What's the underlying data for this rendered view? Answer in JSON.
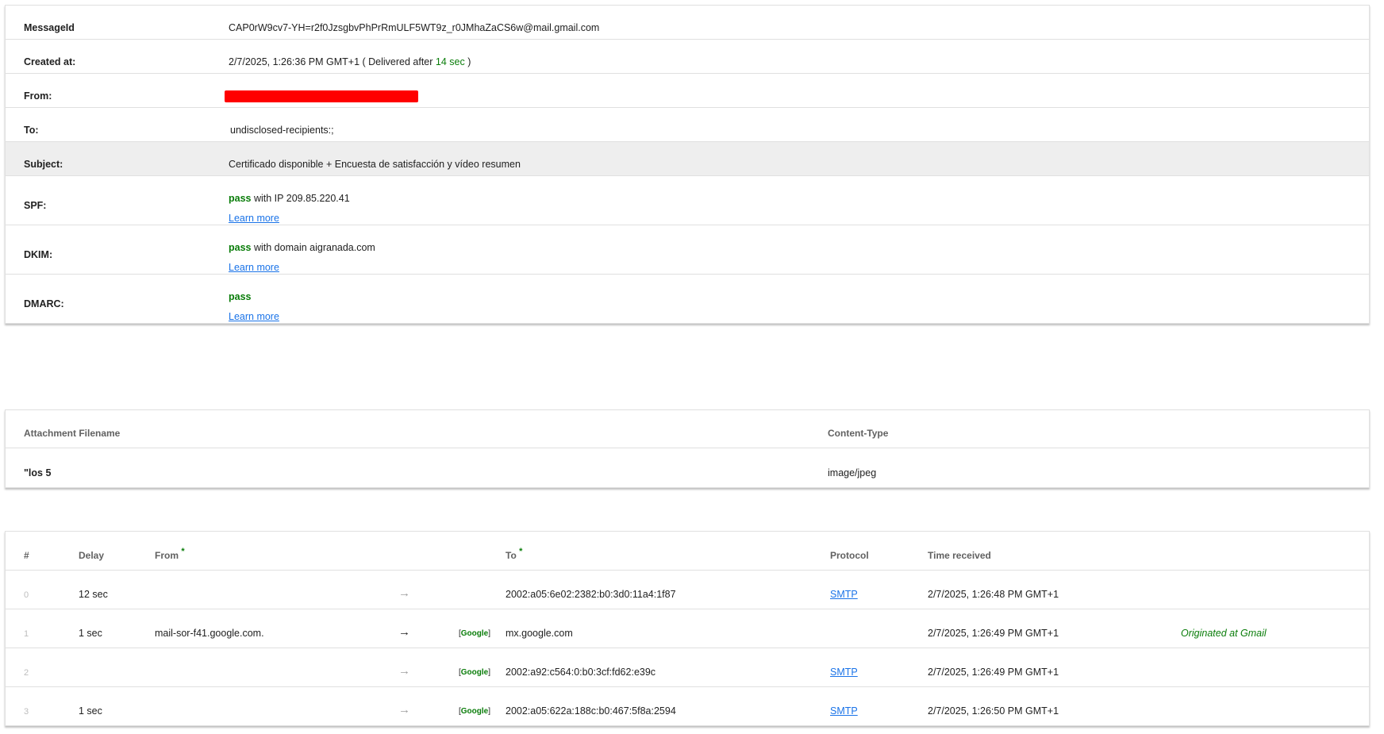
{
  "summary": {
    "rows": [
      {
        "label": "MessageId",
        "value": "CAP0rW9cv7-YH=r2f0JzsgbvPhPrRmULF5WT9z_r0JMhaZaCS6w@mail.gmail.com"
      },
      {
        "label": "Created at:",
        "value": "2/7/2025, 1:26:36 PM GMT+1 ( Delivered after",
        "delay": "14 sec",
        "suffix": ")"
      },
      {
        "label": "From:",
        "value": ""
      },
      {
        "label": "To:",
        "value": "undisclosed-recipients:;"
      },
      {
        "label": "Subject:",
        "value": "Certificado disponible + Encuesta de satisfacción y vídeo resumen"
      },
      {
        "label": "SPF:",
        "result": "pass",
        "detail": "with IP 209.85.220.41",
        "link": "Learn more"
      },
      {
        "label": "DKIM:",
        "result": "pass",
        "detail": "with domain aigranada.com",
        "link": "Learn more"
      },
      {
        "label": "DMARC:",
        "result": "pass",
        "detail": "",
        "link": "Learn more"
      }
    ]
  },
  "attachments": {
    "headers": {
      "filename": "Attachment Filename",
      "content_type": "Content-Type"
    },
    "rows": [
      {
        "filename": "\"los 5",
        "content_type": "image/jpeg"
      }
    ]
  },
  "hops": {
    "headers": {
      "index": "#",
      "delay": "Delay",
      "from": "From",
      "star": "*",
      "to": "To",
      "protocol": "Protocol",
      "time": "Time received"
    },
    "arrow": "→",
    "google_tag": "Google",
    "rows": [
      {
        "index": "0",
        "delay": "12 sec",
        "from": "",
        "tag": "",
        "to": "2002:a05:6e02:2382:b0:3d0:11a4:1f87",
        "protocol": "SMTP",
        "time": "2/7/2025, 1:26:48 PM GMT+1",
        "note": ""
      },
      {
        "index": "1",
        "delay": "1 sec",
        "from": "mail-sor-f41.google.com.",
        "tag": "Google",
        "to": "mx.google.com",
        "protocol": "",
        "time": "2/7/2025, 1:26:49 PM GMT+1",
        "note": "Originated at Gmail"
      },
      {
        "index": "2",
        "delay": "",
        "from": "",
        "tag": "Google",
        "to": "2002:a92:c564:0:b0:3cf:fd62:e39c",
        "protocol": "SMTP",
        "time": "2/7/2025, 1:26:49 PM GMT+1",
        "note": ""
      },
      {
        "index": "3",
        "delay": "1 sec",
        "from": "",
        "tag": "Google",
        "to": "2002:a05:622a:188c:b0:467:5f8a:2594",
        "protocol": "SMTP",
        "time": "2/7/2025, 1:26:50 PM GMT+1",
        "note": ""
      }
    ]
  },
  "colors": {
    "pass": "#0a7d0a",
    "link": "#1a73e8",
    "redaction": "#ff0000",
    "highlight_row": "#eeeeee"
  }
}
